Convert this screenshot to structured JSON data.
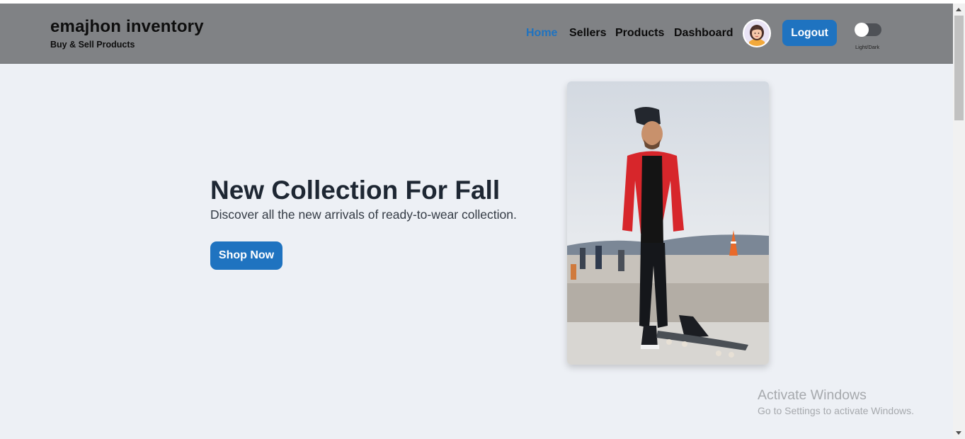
{
  "header": {
    "brand_title": "emajhon inventory",
    "brand_subtitle": "Buy & Sell Products",
    "nav": [
      {
        "label": "Home",
        "active": true
      },
      {
        "label": "Sellers",
        "active": false
      },
      {
        "label": "Products",
        "active": false
      },
      {
        "label": "Dashboard",
        "active": false
      }
    ],
    "avatar_icon": "user-avatar-icon",
    "logout_label": "Logout",
    "theme_toggle_label": "Light/Dark",
    "theme_toggle_state": "off"
  },
  "hero": {
    "title": "New Collection For Fall",
    "subtitle": "Discover all the new arrivals of ready-to-wear collection.",
    "button_label": "Shop Now",
    "image_subject": "man in red jacket standing on skateboard"
  },
  "watermark": {
    "title": "Activate Windows",
    "subtitle": "Go to Settings to activate Windows."
  },
  "colors": {
    "accent": "#1f73c0",
    "header_bg": "#808285",
    "page_bg": "#edf0f5"
  }
}
